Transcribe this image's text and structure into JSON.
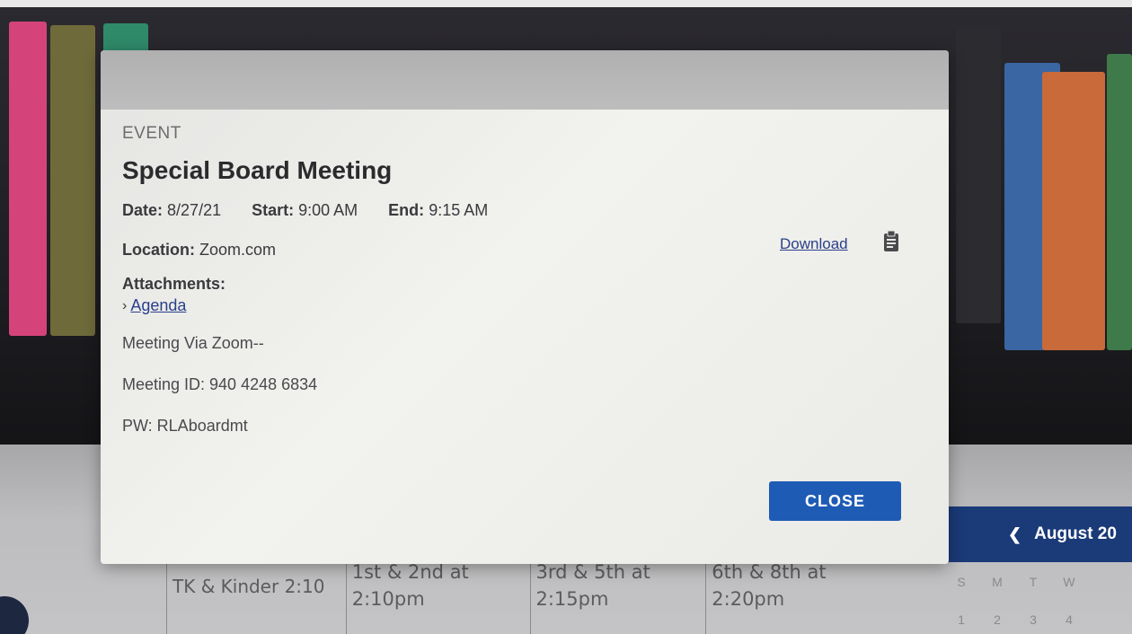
{
  "modal": {
    "kicker": "EVENT",
    "title": "Special Board Meeting",
    "date_label": "Date:",
    "date_value": "8/27/21",
    "start_label": "Start:",
    "start_value": "9:00 AM",
    "end_label": "End:",
    "end_value": "9:15 AM",
    "location_label": "Location:",
    "location_value": "Zoom.com",
    "attachments_label": "Attachments:",
    "attachments": [
      {
        "label": "Agenda"
      }
    ],
    "description": [
      "Meeting Via Zoom--",
      "Meeting ID: 940 4248 6834",
      "PW:  RLAboardmt"
    ],
    "download_label": "Download",
    "download_icon": "clipboard-icon",
    "close_label": "CLOSE",
    "close_color": "#1e5bb5"
  },
  "schedule": {
    "cells": [
      {
        "line1": "TK & Kinder 2:10",
        "line2": ""
      },
      {
        "line1": "1st & 2nd at",
        "line2": "2:10pm"
      },
      {
        "line1": "3rd & 5th at",
        "line2": "2:15pm"
      },
      {
        "line1": "6th & 8th at",
        "line2": "2:20pm"
      }
    ]
  },
  "calendar": {
    "month_label": "August 20",
    "prev_icon": "chevron-left-icon",
    "header_color": "#1a3a78",
    "weekdays": [
      "S",
      "M",
      "T",
      "W"
    ],
    "dates": [
      "1",
      "2",
      "3",
      "4"
    ]
  }
}
